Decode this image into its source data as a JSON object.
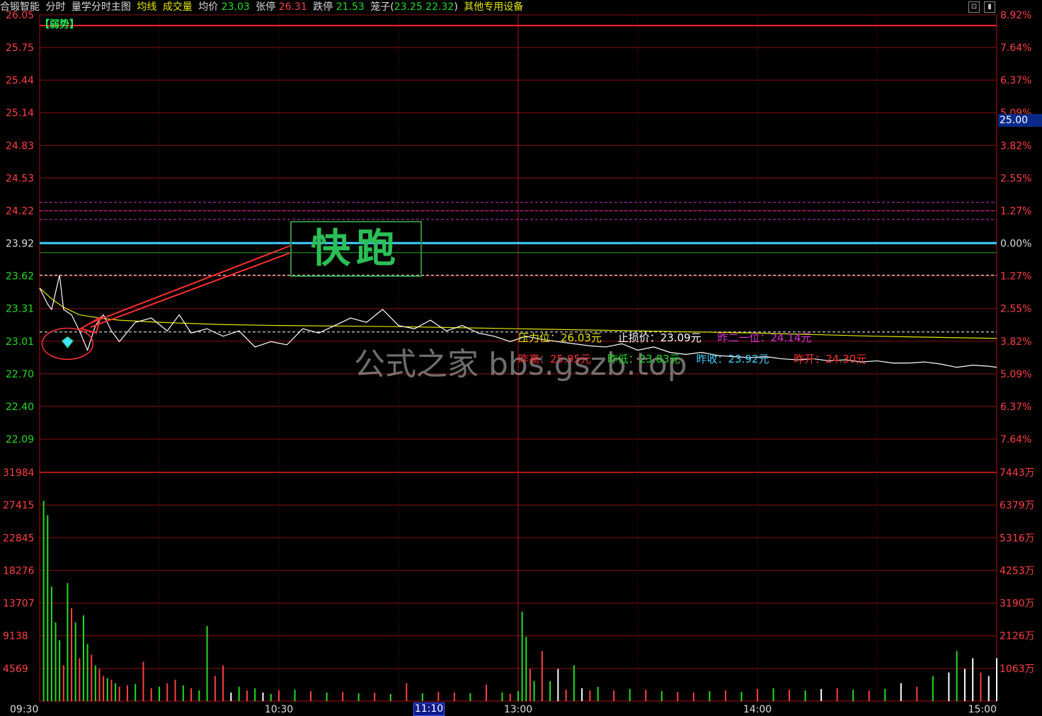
{
  "header": {
    "stock_name": "合锻智能",
    "mode": "分时",
    "formula_name": "量学分时主图",
    "avg_line_label": "均线",
    "volume_label": "成交量",
    "avg_price_label": "均价",
    "avg_price_value": "23.03",
    "limit_up_label": "张停",
    "limit_up_value": "26.31",
    "limit_down_label": "跌停",
    "limit_down_value": "21.53",
    "cage_label": "笼子(",
    "cage_value": "23.25 22.32",
    "cage_close": ")",
    "device_label": "其他专用设备",
    "colors": {
      "name": "#dddddd",
      "avg_line": "#e6e600",
      "volume": "#e6e600",
      "up": "#ff4040",
      "down": "#22dd22",
      "label": "#dddddd"
    }
  },
  "weak_tag": "【弱势】",
  "annotation": {
    "text": "快跑",
    "color": "#2bbf55",
    "arrow_color": "#ff3030"
  },
  "watermark": {
    "text": "公式之家 bbs.gszb.top"
  },
  "current_price_tag": "25.00",
  "time_cursor": "11:10",
  "info": {
    "pressure_label": "压力位：",
    "pressure_value": "26.03元",
    "stop_label": "止损价：",
    "stop_value": "23.09元",
    "prev_second_label": "昨二一位：",
    "prev_second_value": "24.14元",
    "prev_high_label": "昨高：",
    "prev_high_value": "25.95元",
    "prev_low_label": "昨低：",
    "prev_low_value": "23.83元",
    "prev_close_label": "昨收：",
    "prev_close_value": "23.92元",
    "prev_open_label": "昨开：",
    "prev_open_value": "24.30元"
  },
  "chart_data": {
    "type": "line",
    "price_axis": {
      "ticks": [
        "26.05",
        "25.75",
        "25.44",
        "25.14",
        "24.83",
        "24.53",
        "24.22",
        "23.92",
        "23.62",
        "23.31",
        "23.01",
        "22.70",
        "22.40",
        "22.09"
      ],
      "pct_ticks": [
        "8.92%",
        "7.64%",
        "6.37%",
        "5.09%",
        "3.82%",
        "2.55%",
        "1.27%",
        "0.00%",
        "1.27%",
        "2.55%",
        "3.82%",
        "5.09%",
        "6.37%",
        "7.64%"
      ],
      "ylim": [
        22.09,
        26.05
      ],
      "prev_close": 23.92
    },
    "volume_axis": {
      "ticks": [
        "31984",
        "27415",
        "22845",
        "18276",
        "13707",
        "9138",
        "4569"
      ],
      "amount_ticks": [
        "7443万",
        "6379万",
        "5316万",
        "4253万",
        "3190万",
        "2126万",
        "1063万"
      ],
      "ylim": [
        0,
        31984
      ]
    },
    "time_ticks": [
      "09:30",
      "10:30",
      "13:00",
      "14:00",
      "15:00"
    ],
    "time_tick_minutes": [
      0,
      60,
      120,
      180,
      240
    ],
    "levels": [
      {
        "price": 25.95,
        "color": "#ff2020"
      },
      {
        "price": 24.3,
        "color": "#cc33cc"
      },
      {
        "price": 24.22,
        "color": "#cc33cc"
      },
      {
        "price": 24.14,
        "color": "#cc33cc"
      },
      {
        "price": 23.92,
        "color": "#40d0ff"
      },
      {
        "price": 23.83,
        "color": "#22aa22"
      },
      {
        "price": 23.62,
        "color": "#ffffff"
      },
      {
        "price": 23.09,
        "color": "#ffffff"
      }
    ],
    "price_series": {
      "minutes": [
        0,
        2,
        3,
        5,
        6,
        8,
        10,
        12,
        14,
        16,
        18,
        20,
        24,
        28,
        32,
        35,
        38,
        42,
        46,
        50,
        54,
        58,
        62,
        66,
        70,
        74,
        78,
        82,
        86,
        90,
        94,
        98,
        102,
        106,
        110,
        114,
        118,
        122,
        126,
        130,
        134,
        138,
        142,
        146,
        150,
        154,
        158,
        162,
        166,
        170,
        174,
        178,
        182,
        186,
        190,
        194,
        198,
        202,
        206,
        210,
        214,
        218,
        222,
        226,
        230,
        234,
        238,
        240
      ],
      "values": [
        23.5,
        23.35,
        23.3,
        23.62,
        23.3,
        23.25,
        23.1,
        22.92,
        23.15,
        23.25,
        23.1,
        23.0,
        23.18,
        23.22,
        23.1,
        23.25,
        23.08,
        23.12,
        23.05,
        23.1,
        22.95,
        23.0,
        22.97,
        23.12,
        23.08,
        23.15,
        23.22,
        23.18,
        23.3,
        23.15,
        23.12,
        23.2,
        23.1,
        23.15,
        23.08,
        23.05,
        23.0,
        23.05,
        23.02,
        23.0,
        22.98,
        22.96,
        22.95,
        22.98,
        22.92,
        22.95,
        22.9,
        22.88,
        22.9,
        22.87,
        22.86,
        22.85,
        22.86,
        22.84,
        22.83,
        22.84,
        22.82,
        22.83,
        22.81,
        22.82,
        22.8,
        22.8,
        22.81,
        22.79,
        22.76,
        22.78,
        22.77,
        22.76
      ]
    },
    "avg_series": {
      "minutes": [
        0,
        3,
        6,
        10,
        15,
        20,
        30,
        45,
        60,
        90,
        120,
        150,
        180,
        210,
        240
      ],
      "values": [
        23.5,
        23.4,
        23.32,
        23.25,
        23.22,
        23.2,
        23.18,
        23.16,
        23.15,
        23.14,
        23.12,
        23.1,
        23.08,
        23.05,
        23.03
      ]
    },
    "volume_series": {
      "minutes": [
        1,
        2,
        3,
        4,
        5,
        6,
        7,
        8,
        9,
        10,
        11,
        12,
        13,
        14,
        15,
        16,
        17,
        18,
        19,
        20,
        22,
        24,
        26,
        28,
        30,
        32,
        34,
        36,
        38,
        40,
        42,
        44,
        46,
        48,
        50,
        52,
        54,
        56,
        58,
        60,
        64,
        68,
        72,
        76,
        80,
        84,
        88,
        92,
        96,
        100,
        104,
        108,
        112,
        116,
        118,
        120,
        121,
        122,
        123,
        124,
        126,
        128,
        130,
        132,
        134,
        136,
        138,
        140,
        144,
        148,
        152,
        156,
        160,
        164,
        168,
        172,
        176,
        180,
        184,
        188,
        192,
        196,
        200,
        204,
        208,
        212,
        216,
        220,
        224,
        228,
        230,
        232,
        234,
        236,
        238,
        240
      ],
      "values": [
        28000,
        26000,
        16000,
        11000,
        8500,
        5000,
        16500,
        13000,
        11000,
        6000,
        12000,
        8000,
        6500,
        5000,
        4500,
        3500,
        3200,
        3000,
        2500,
        2000,
        2200,
        2400,
        5500,
        1800,
        2000,
        2500,
        3000,
        2200,
        1800,
        1500,
        10500,
        3500,
        5000,
        1200,
        2000,
        1500,
        1800,
        1200,
        1000,
        1500,
        1600,
        1400,
        1200,
        1300,
        1100,
        1200,
        1000,
        2500,
        1100,
        1300,
        1200,
        1100,
        2300,
        1200,
        1000,
        1400,
        12500,
        9000,
        4500,
        2800,
        7000,
        2800,
        4500,
        1600,
        5000,
        1800,
        1500,
        2000,
        1500,
        1700,
        1600,
        1400,
        1300,
        1200,
        1400,
        1500,
        1300,
        1700,
        1800,
        1600,
        1500,
        1700,
        1800,
        1600,
        1500,
        1700,
        2500,
        2000,
        3500,
        4000,
        7000,
        4500,
        6000,
        4000,
        3500,
        6000
      ],
      "colors": [
        "g",
        "g",
        "g",
        "g",
        "g",
        "r",
        "g",
        "r",
        "g",
        "r",
        "g",
        "g",
        "r",
        "g",
        "r",
        "r",
        "g",
        "r",
        "g",
        "r",
        "r",
        "g",
        "r",
        "r",
        "g",
        "r",
        "r",
        "g",
        "r",
        "g",
        "g",
        "r",
        "r",
        "w",
        "g",
        "r",
        "g",
        "w",
        "g",
        "r",
        "g",
        "r",
        "g",
        "r",
        "g",
        "r",
        "g",
        "r",
        "g",
        "r",
        "r",
        "g",
        "r",
        "g",
        "r",
        "g",
        "g",
        "g",
        "r",
        "g",
        "r",
        "g",
        "w",
        "r",
        "g",
        "w",
        "r",
        "g",
        "r",
        "g",
        "r",
        "g",
        "r",
        "r",
        "g",
        "r",
        "g",
        "r",
        "g",
        "r",
        "g",
        "w",
        "r",
        "g",
        "r",
        "g",
        "w",
        "r",
        "g",
        "w",
        "g",
        "w",
        "w",
        "r",
        "w",
        "w"
      ]
    }
  }
}
